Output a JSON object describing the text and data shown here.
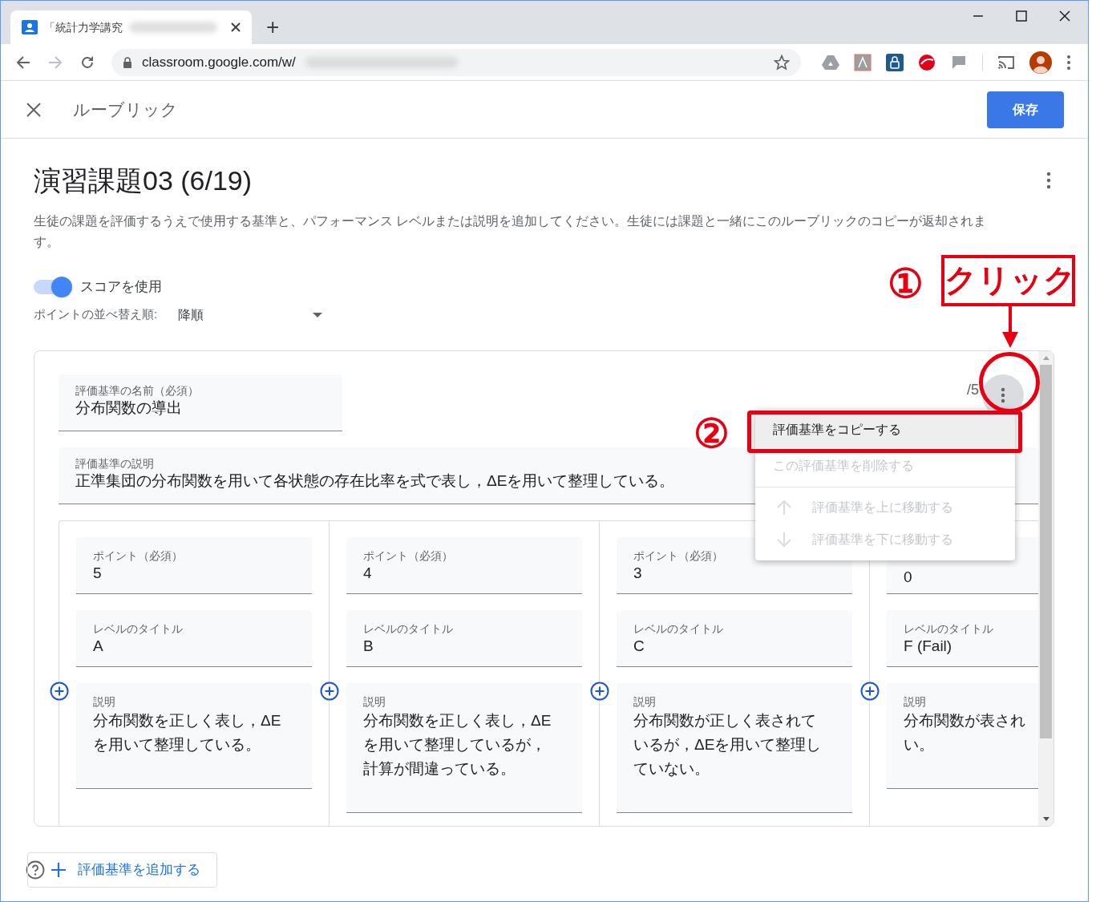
{
  "browser": {
    "tab_title": "「統計力学講究",
    "new_tab": "+",
    "url": "classroom.google.com/w/"
  },
  "header": {
    "title": "ルーブリック",
    "save": "保存"
  },
  "rubric": {
    "title": "演習課題03 (6/19)",
    "description": "生徒の課題を評価するうえで使用する基準と、パフォーマンス レベルまたは説明を追加してください。生徒には課題と一緒にこのルーブリックのコピーが返却されます。",
    "use_score": {
      "label": "スコアを使用",
      "on": true
    },
    "sort": {
      "label": "ポイントの並べ替え順:",
      "value": "降順"
    }
  },
  "criterion": {
    "name_label": "評価基準の名前（必須）",
    "name": "分布関数の導出",
    "desc_label": "評価基準の説明",
    "description": "正準集団の分布関数を用いて各状態の存在比率を式で表し，ΔEを用いて整理している。",
    "max_points": "/5"
  },
  "levels": [
    {
      "points_label": "ポイント（必須）",
      "points": "5",
      "title_label": "レベルのタイトル",
      "title": "A",
      "desc_label": "説明",
      "desc_lines": [
        "分布関数を正しく表し，ΔE",
        "を用いて整理している。"
      ]
    },
    {
      "points_label": "ポイント（必須）",
      "points": "4",
      "title_label": "レベルのタイトル",
      "title": "B",
      "desc_label": "説明",
      "desc_lines": [
        "分布関数を正しく表し，ΔE",
        "を用いて整理しているが，",
        "計算が間違っている。"
      ]
    },
    {
      "points_label": "ポイント（必須）",
      "points": "3",
      "title_label": "レベルのタイトル",
      "title": "C",
      "desc_label": "説明",
      "desc_lines": [
        "分布関数が正しく表されて",
        "いるが，ΔEを用いて整理し",
        "ていない。"
      ]
    },
    {
      "points": "0",
      "title_label": "レベルのタイトル",
      "title": "F (Fail)",
      "desc_label": "説明",
      "desc_lines": [
        "分布関数が表され",
        "い。"
      ]
    }
  ],
  "menu": {
    "items": [
      {
        "label": "評価基準をコピーする",
        "kind": "plain",
        "disabled": false,
        "selected": true
      },
      {
        "label": "この評価基準を削除する",
        "kind": "plain",
        "disabled": true,
        "selected": false
      },
      {
        "label": "評価基準を上に移動する",
        "kind": "move-up",
        "disabled": true,
        "selected": false
      },
      {
        "label": "評価基準を下に移動する",
        "kind": "move-down",
        "disabled": true,
        "selected": false
      }
    ]
  },
  "annotations": [
    {
      "kind": "step",
      "text": "①"
    },
    {
      "kind": "callout",
      "text": "クリック"
    },
    {
      "kind": "step",
      "text": "②"
    }
  ],
  "add_criterion": "評価基準を追加する"
}
